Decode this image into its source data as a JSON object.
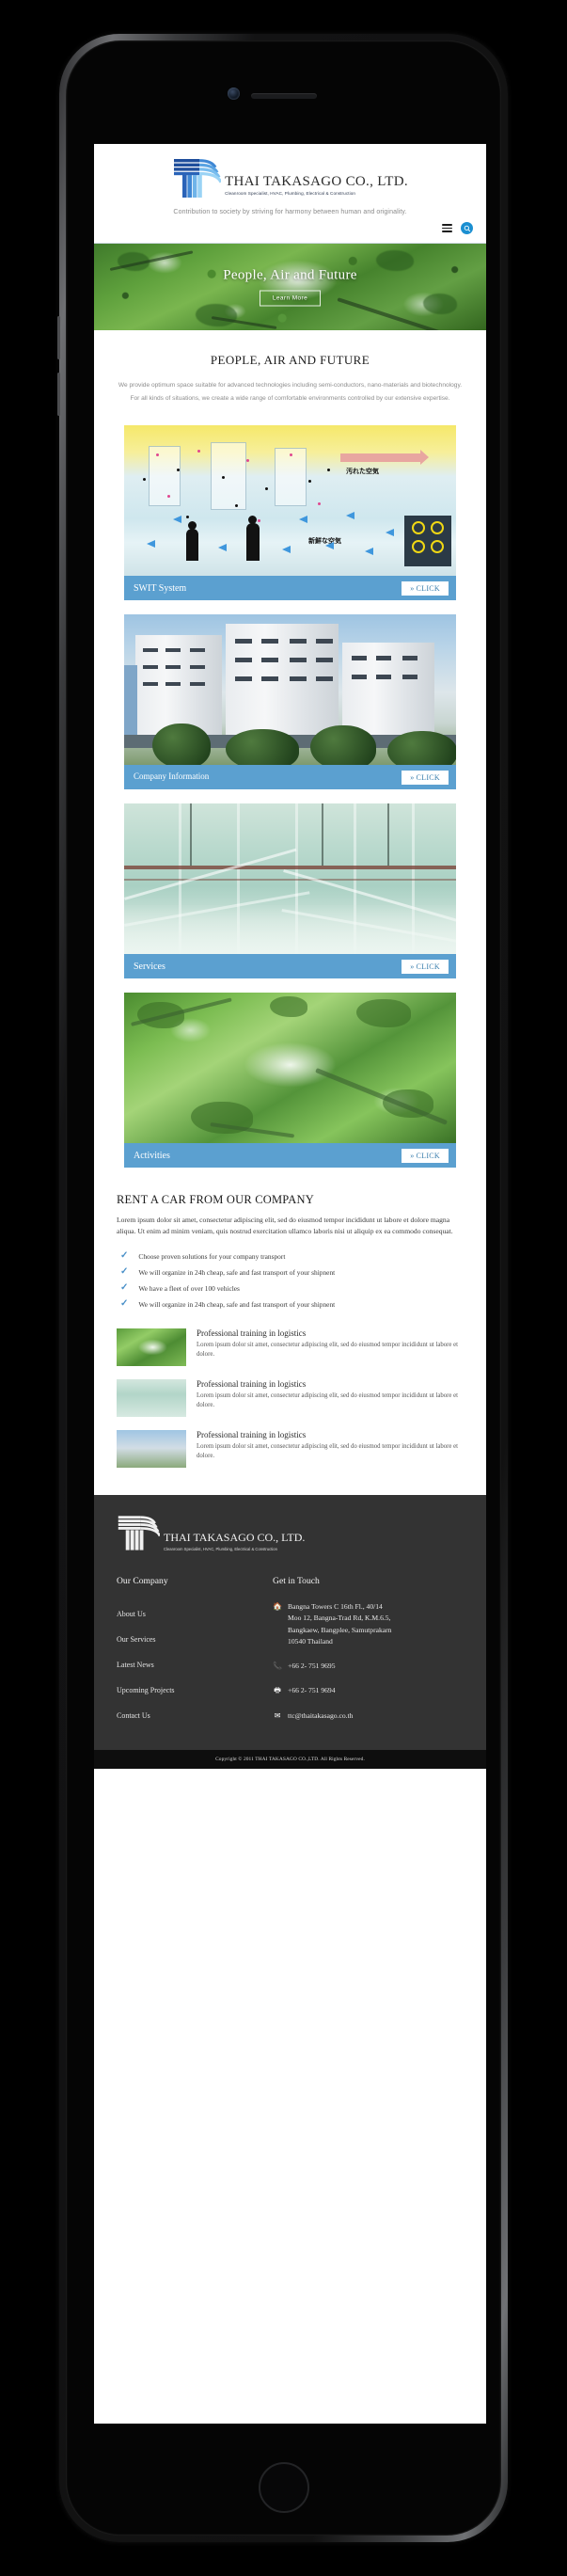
{
  "device": {
    "frame": "smartphone"
  },
  "header": {
    "logo_name": "THAI TAKASAGO CO., LTD.",
    "logo_subtitle": "Cleanroom Specialist, HVAC, Plumbing, Electrical & Construction",
    "tagline": "Contribution to society by striving for harmony between human and originality.",
    "menu_icon": "hamburger-icon",
    "search_icon": "search-icon"
  },
  "hero": {
    "title": "People, Air and Future",
    "button": "Learn More"
  },
  "intro": {
    "heading": "PEOPLE, AIR AND FUTURE",
    "paragraph1": "We provide optimum space suitable for advanced technologies including semi-conductors, nano-materials and biotechnology.",
    "paragraph2": "For all kinds of situations, we create a wide range of comfortable environments controlled by our extensive expertise."
  },
  "cards": [
    {
      "label": "SWIT System",
      "button": "CLICK",
      "image": "swit-system-diagram"
    },
    {
      "label": "Company Information",
      "button": "CLICK",
      "image": "company-building-photo"
    },
    {
      "label": "Services",
      "button": "CLICK",
      "image": "cleanroom-pipes-photo"
    },
    {
      "label": "Activities",
      "button": "CLICK",
      "image": "forest-canopy-photo"
    }
  ],
  "card_diagram_labels": {
    "dirty_air": "汚れた空気",
    "fresh_air": "新鮮な空気"
  },
  "rent": {
    "heading": "RENT A CAR FROM OUR COMPANY",
    "body": "Lorem ipsum dolor sit amet, consectetur adipiscing elit, sed do eiusmod tempor incididunt ut labore et dolore magna aliqua. Ut enim ad minim veniam, quis nostrud exercitation ullamco laboris nisi ut aliquip ex ea commodo consequat.",
    "checklist": [
      "Choose proven solutions for your company transport",
      "We will organize in 24h cheap, safe and fast transport of your shipnent",
      "We have a fleet of over 100 vehicles",
      "We will organize in 24h cheap, safe and fast transport of your shipnent"
    ]
  },
  "news": [
    {
      "title": "Professional training in logistics",
      "desc": "Lorem ipsum dolor sit amet, consectetur adipiscing elit, sed do eiusmod tempor incididunt ut labore et dolore.",
      "thumb": "forest-canopy-thumb"
    },
    {
      "title": "Professional training in logistics",
      "desc": "Lorem ipsum dolor sit amet, consectetur adipiscing elit, sed do eiusmod tempor incididunt ut labore et dolore.",
      "thumb": "cleanroom-pipes-thumb"
    },
    {
      "title": "Professional training in logistics",
      "desc": "Lorem ipsum dolor sit amet, consectetur adipiscing elit, sed do eiusmod tempor incididunt ut labore et dolore.",
      "thumb": "building-thumb"
    }
  ],
  "footer": {
    "logo_name": "THAI TAKASAGO CO., LTD.",
    "logo_subtitle": "Cleanroom Specialist, HVAC, Plumbing, Electrical & Construction",
    "company_heading": "Our Company",
    "company_links": [
      "About Us",
      "Our Services",
      "Latest News",
      "Upcoming Projects",
      "Contact Us"
    ],
    "contact_heading": "Get in Touch",
    "address_line1": "Bangna Towers C 16th Fl., 40/14",
    "address_line2": "Moo 12, Bangna-Trad Rd, K.M.6.5,",
    "address_line3": "Bangkaew, Bangplee, Samutprakarn",
    "address_line4": "10540 Thailand",
    "phone": "+66 2- 751 9695",
    "fax": "+66 2- 751 9694",
    "email": "ttc@thaitakasago.co.th",
    "address_icon": "home-icon",
    "phone_icon": "phone-icon",
    "fax_icon": "fax-icon",
    "email_icon": "envelope-icon"
  },
  "copyright": "Copyright © 2011 THAI TAKASAGO CO.,LTD. All Rights Reserved.",
  "colors": {
    "accent_blue": "#5ba0d0",
    "search_blue": "#1b8fd1",
    "check_blue": "#4a90c8",
    "footer_bg": "#333333",
    "copyright_bg": "#0e0e0e"
  }
}
